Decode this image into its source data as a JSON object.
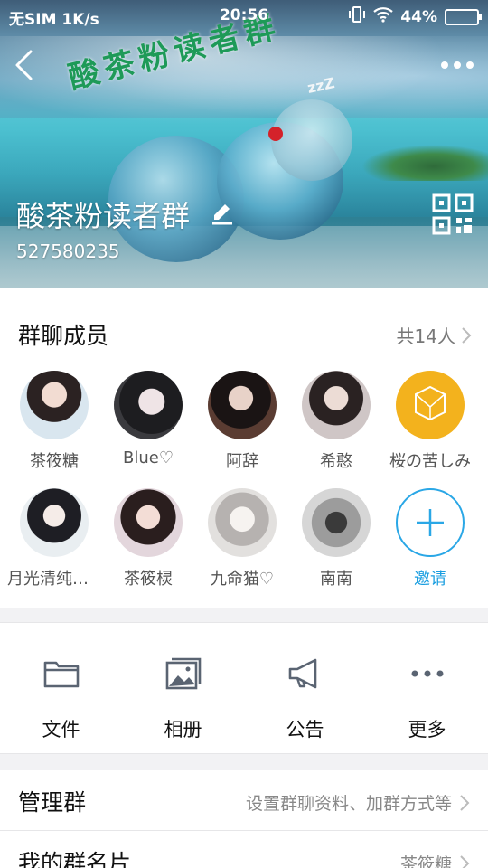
{
  "status_bar": {
    "carrier": "无SIM",
    "speed": "1K/s",
    "time": "20:56",
    "battery": "44%"
  },
  "hero": {
    "banner_text": "酸茶粉读者群",
    "zzz": "zzZ",
    "group_name": "酸茶粉读者群",
    "group_id": "527580235"
  },
  "members": {
    "title": "群聊成员",
    "count_label": "共14人",
    "list": [
      {
        "name": "茶筱糖"
      },
      {
        "name": "Blue♡"
      },
      {
        "name": "阿辞"
      },
      {
        "name": "希憨"
      },
      {
        "name": "桜の苦しみ"
      },
      {
        "name": "月光清纯少女"
      },
      {
        "name": "茶筱棂"
      },
      {
        "name": "九命猫♡"
      },
      {
        "name": "南南"
      }
    ],
    "invite_label": "邀请"
  },
  "actions": [
    {
      "label": "文件",
      "icon": "folder-icon"
    },
    {
      "label": "相册",
      "icon": "photo-album-icon"
    },
    {
      "label": "公告",
      "icon": "megaphone-icon"
    },
    {
      "label": "更多",
      "icon": "more-dots-icon"
    }
  ],
  "rows": {
    "manage": {
      "label": "管理群",
      "value": "设置群聊资料、加群方式等"
    },
    "my_card": {
      "label": "我的群名片",
      "value": "茶筱糖"
    }
  },
  "colors": {
    "accent": "#2aa7e6",
    "banner_green": "#1e9a58"
  }
}
